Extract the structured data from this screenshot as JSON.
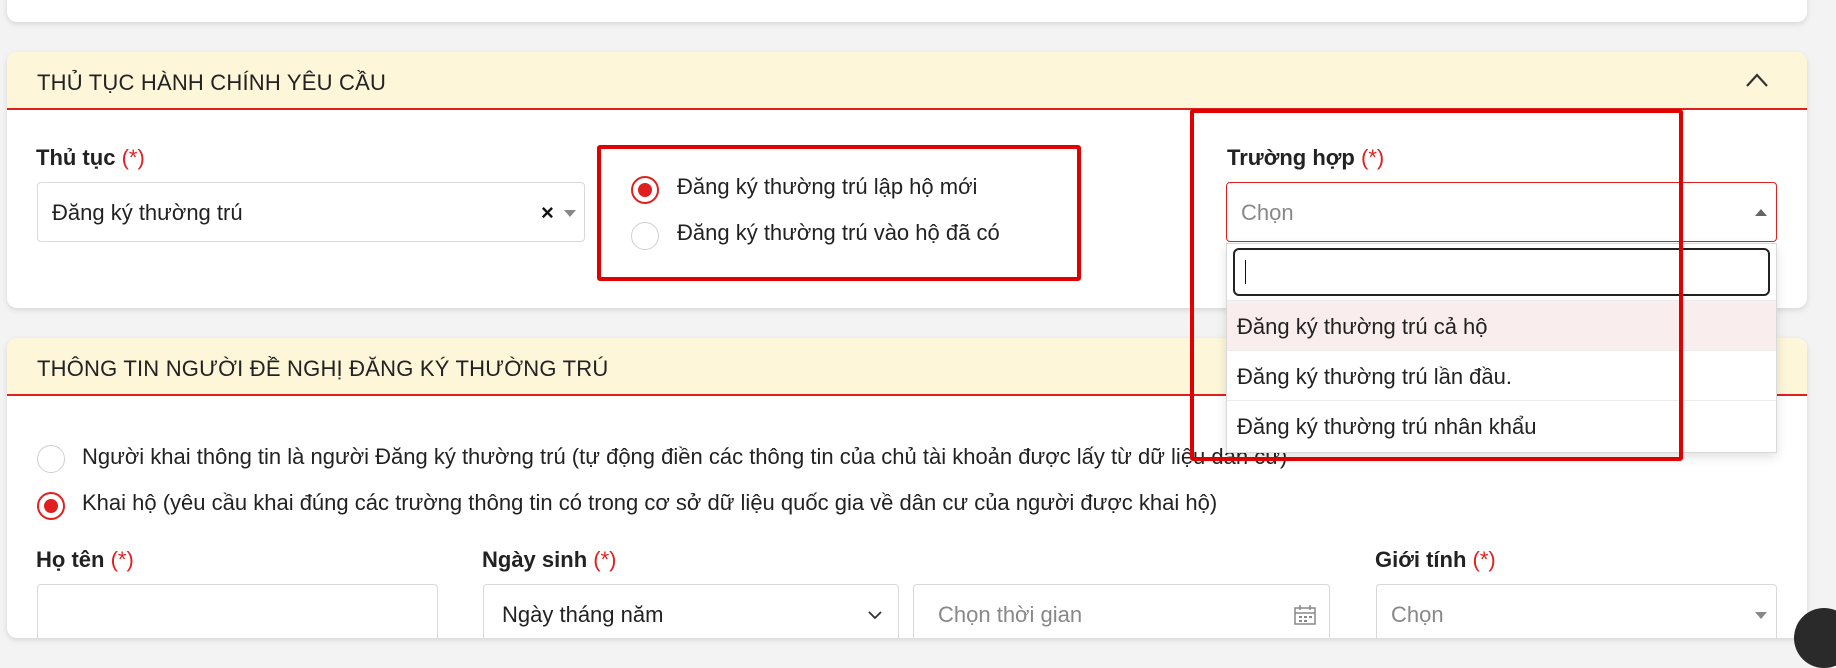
{
  "section1": {
    "title": "THỦ TỤC HÀNH CHÍNH YÊU CẦU",
    "procedure_label": "Thủ tục",
    "required_mark": "(*)",
    "procedure_value": "Đăng ký thường trú",
    "radio_options": [
      "Đăng ký thường trú lập hộ mới",
      "Đăng ký thường trú vào hộ đã có"
    ],
    "case_label": "Trường hợp",
    "case_placeholder": "Chọn",
    "dropdown_options": [
      "Đăng ký thường trú cả hộ",
      "Đăng ký thường trú lần đầu.",
      "Đăng ký thường trú nhân khẩu"
    ]
  },
  "section2": {
    "title": "THÔNG TIN NGƯỜI ĐỀ NGHỊ ĐĂNG KÝ THƯỜNG TRÚ",
    "radio_options": [
      "Người khai thông tin là người Đăng ký thường trú (tự động điền các thông tin của chủ tài khoản được lấy từ dữ liệu dân cư)",
      "Khai hộ (yêu cầu khai đúng các trường thông tin có trong cơ sở dữ liệu quốc gia về dân cư của người được khai hộ)"
    ],
    "name_label": "Họ tên",
    "dob_label": "Ngày sinh",
    "dob_format_value": "Ngày tháng năm",
    "dob_placeholder": "Chọn thời gian",
    "gender_label": "Giới tính",
    "gender_placeholder": "Chọn"
  },
  "colors": {
    "accent": "#e0201f",
    "header_bg": "#fdf6d9",
    "highlight_frame": "#e00000"
  }
}
